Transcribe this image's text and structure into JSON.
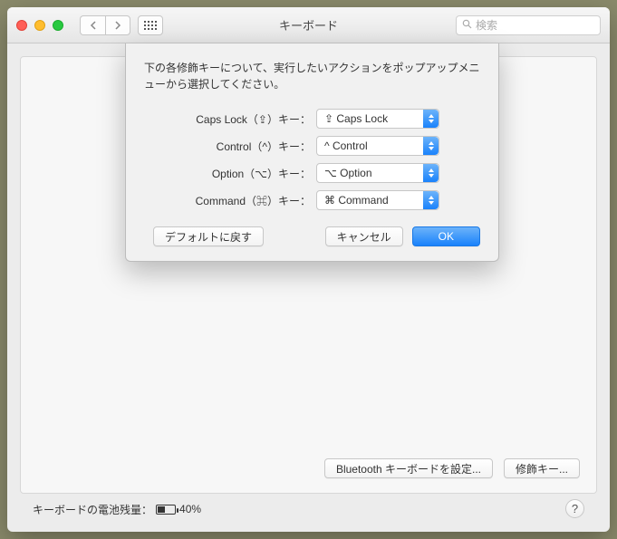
{
  "window": {
    "title": "キーボード"
  },
  "search": {
    "placeholder": "検索"
  },
  "sheet": {
    "description": "下の各修飾キーについて、実行したいアクションをポップアップメニューから選択してください。",
    "rows": {
      "capslock": {
        "label": "Caps Lock（⇪）キー：",
        "value": "⇪ Caps Lock"
      },
      "control": {
        "label": "Control（^）キー：",
        "value": "^ Control"
      },
      "option": {
        "label": "Option（⌥）キー：",
        "value": "⌥ Option"
      },
      "command": {
        "label": "Command（⌘）キー：",
        "value": "⌘ Command"
      }
    },
    "buttons": {
      "defaults": "デフォルトに戻す",
      "cancel": "キャンセル",
      "ok": "OK"
    }
  },
  "panel": {
    "bluetooth_button": "Bluetooth キーボードを設定...",
    "modifier_button": "修飾キー..."
  },
  "status": {
    "battery_label": "キーボードの電池残量：",
    "battery_percent": "40%"
  },
  "help": {
    "label": "?"
  }
}
